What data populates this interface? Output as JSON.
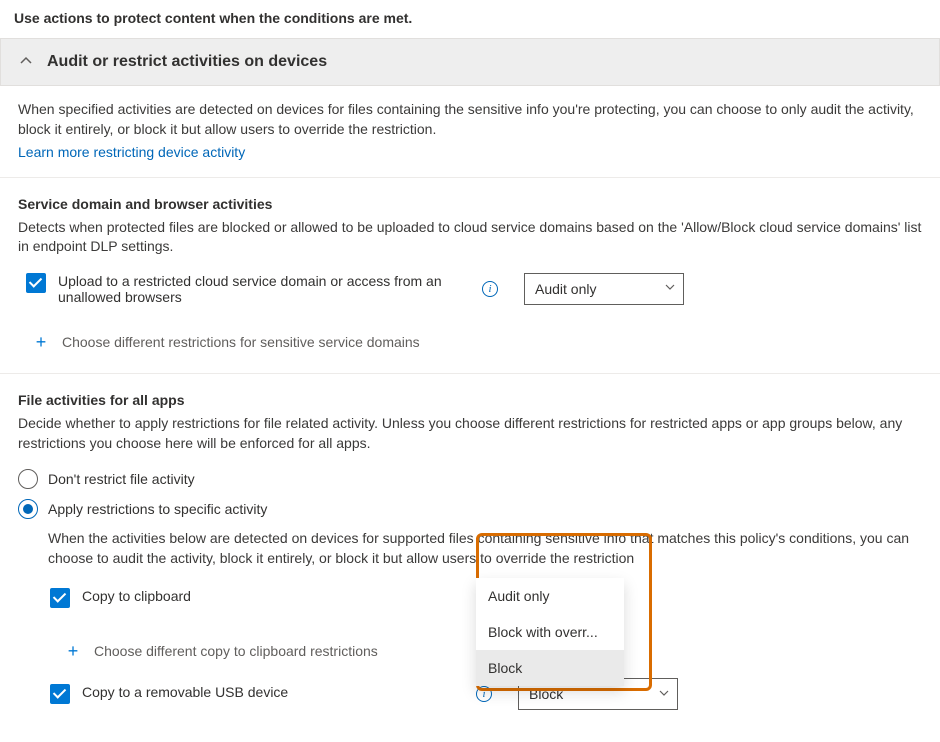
{
  "intro_text": "Use actions to protect content when the conditions are met.",
  "accordion": {
    "title": "Audit or restrict activities on devices"
  },
  "desc": {
    "text": "When specified activities are detected on devices for files containing the sensitive info you're protecting, you can choose to only audit the activity, block it entirely, or block it but allow users to override the restriction.",
    "link": "Learn more restricting device activity"
  },
  "serviceDomain": {
    "title": "Service domain and browser activities",
    "desc": "Detects when protected files are blocked or allowed to be uploaded to cloud service domains based on the 'Allow/Block cloud service domains' list in endpoint DLP settings.",
    "upload_label": "Upload to a restricted cloud service domain or access from an unallowed browsers",
    "upload_action": "Audit only",
    "add_restrictions": "Choose different restrictions for sensitive service domains"
  },
  "fileActivities": {
    "title": "File activities for all apps",
    "desc": "Decide whether to apply restrictions for file related activity. Unless you choose different restrictions for restricted apps or app groups below, any restrictions you choose here will be enforced for all apps.",
    "radio_dont": "Don't restrict file activity",
    "radio_apply": "Apply restrictions to specific activity",
    "apply_desc": "When the activities below are detected on devices for supported files containing sensitive info that matches this policy's conditions, you can choose to audit the activity, block it entirely, or block it but allow users to override the restriction",
    "copy_clipboard": "Copy to clipboard",
    "copy_clipboard_add": "Choose different copy to clipboard restrictions",
    "copy_usb": "Copy to a removable USB device",
    "copy_usb_action": "Block",
    "dropdown_opts": {
      "a": "Audit only",
      "b": "Block with overr...",
      "c": "Block"
    }
  }
}
